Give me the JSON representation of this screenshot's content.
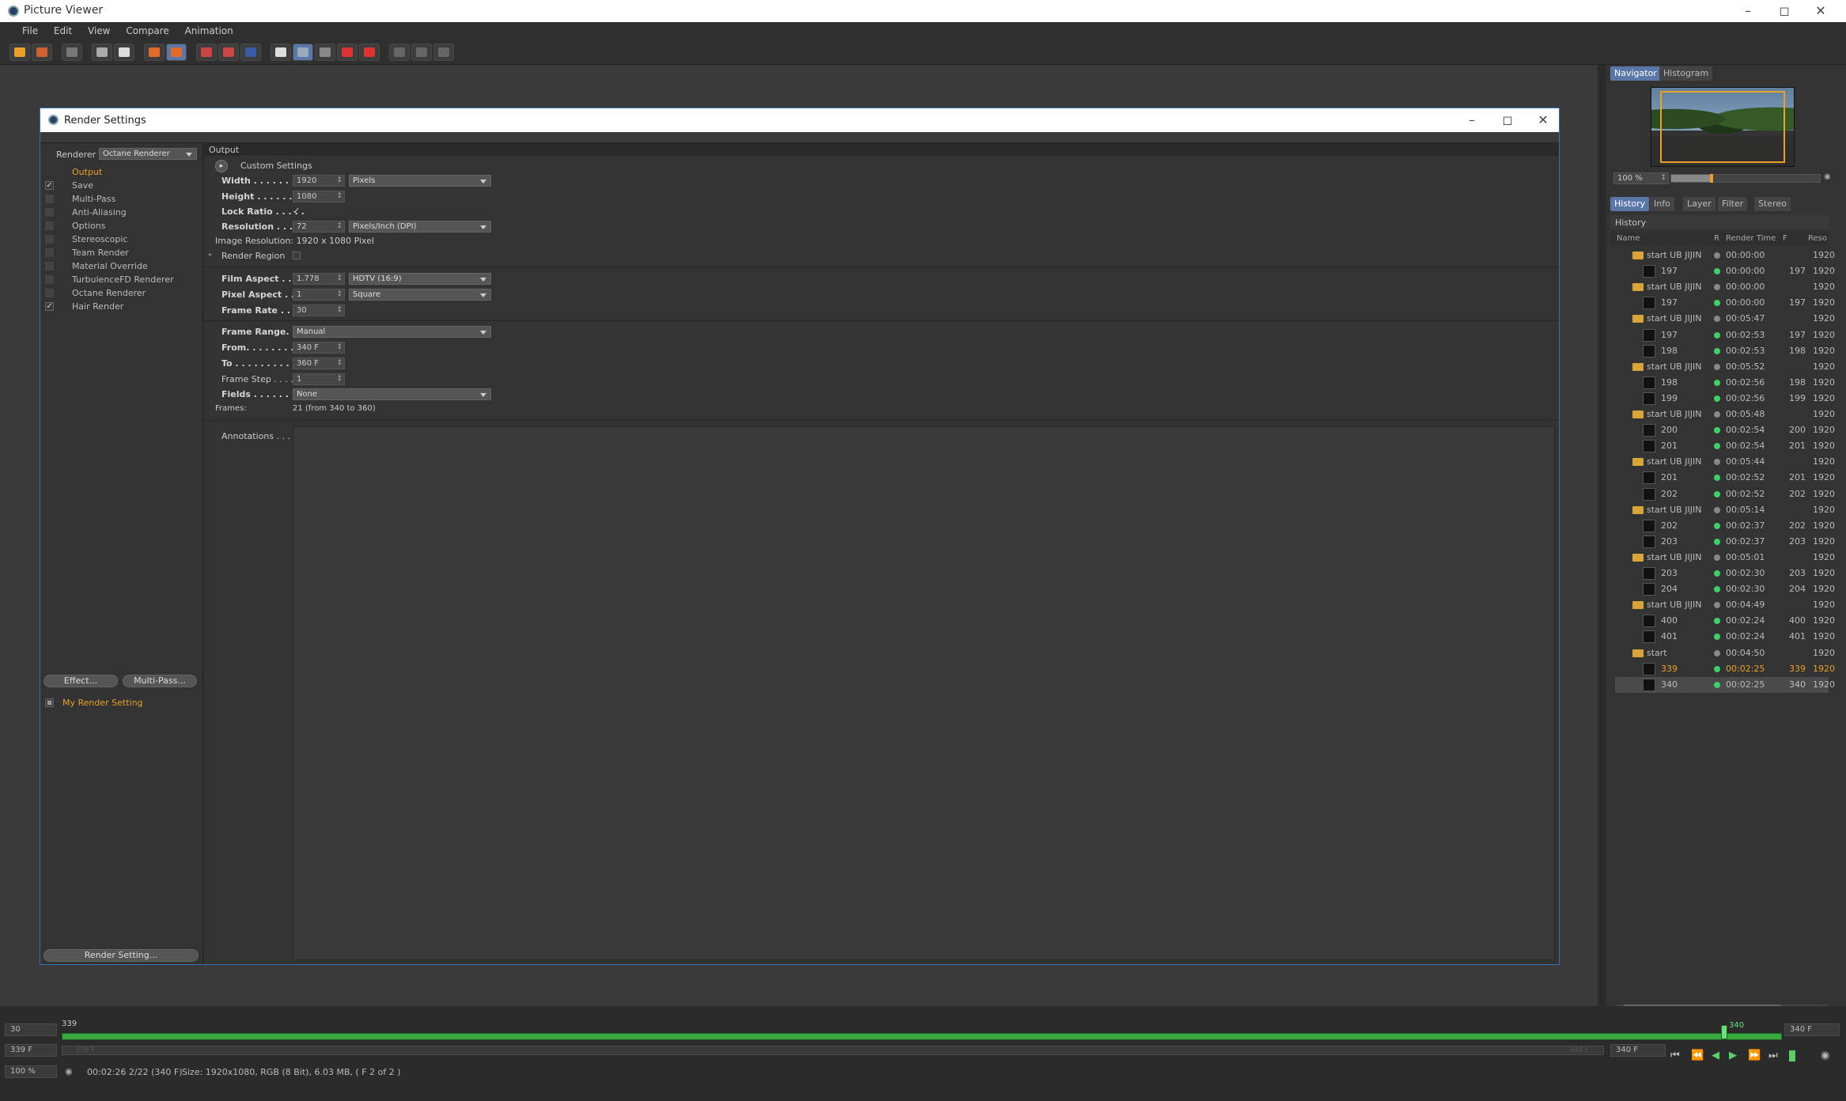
{
  "app": {
    "title": "Picture Viewer"
  },
  "menu": [
    "File",
    "Edit",
    "View",
    "Compare",
    "Animation"
  ],
  "window_controls": {
    "minimize": "–",
    "maximize": "◻",
    "close": "✕"
  },
  "dialog": {
    "title": "Render Settings",
    "renderer_label": "Renderer",
    "renderer_value": "Octane Renderer",
    "section_title": "Output",
    "settings_tree": [
      {
        "label": "Output",
        "checked": "",
        "active": true
      },
      {
        "label": "Save",
        "checked": "✓"
      },
      {
        "label": "Multi-Pass",
        "checked": ""
      },
      {
        "label": "Anti-Aliasing",
        "checked": ""
      },
      {
        "label": "Options",
        "checked": ""
      },
      {
        "label": "Stereoscopic",
        "checked": ""
      },
      {
        "label": "Team Render",
        "checked": ""
      },
      {
        "label": "Material Override",
        "checked": ""
      },
      {
        "label": "TurbulenceFD Renderer",
        "checked": ""
      },
      {
        "label": "Octane Renderer",
        "checked": ""
      },
      {
        "label": "Hair Render",
        "checked": "✓"
      }
    ],
    "effect_button": "Effect...",
    "multipass_button": "Multi-Pass...",
    "render_setting_name": "My Render Setting",
    "render_setting_button": "Render Setting...",
    "output": {
      "preset_label": "Custom Settings",
      "width_label": "Width . . . . . . . . .",
      "width_value": "1920",
      "width_unit": "Pixels",
      "height_label": "Height . . . . . . . .",
      "height_value": "1080",
      "lock_ratio_label": "Lock Ratio . . . . .",
      "lock_ratio_check": "✓",
      "resolution_label": "Resolution . . . . .",
      "resolution_value": "72",
      "resolution_unit": "Pixels/Inch (DPI)",
      "image_resolution": "Image Resolution: 1920 x 1080 Pixel",
      "render_region_label": "Render Region",
      "film_aspect_label": "Film Aspect . . . .",
      "film_aspect_value": "1.778",
      "film_aspect_preset": "HDTV (16:9)",
      "pixel_aspect_label": "Pixel Aspect . . .",
      "pixel_aspect_value": "1",
      "pixel_aspect_preset": "Square",
      "frame_rate_label": "Frame Rate . . . .",
      "frame_rate_value": "30",
      "frame_range_label": "Frame Range. . .",
      "frame_range_value": "Manual",
      "from_label": "From. . . . . . . . . . .",
      "from_value": "340 F",
      "to_label": "To . . . . . . . . . . . .",
      "to_value": "360 F",
      "frame_step_label": "Frame Step . . . .",
      "frame_step_value": "1",
      "fields_label": "Fields . . . . . . . . .",
      "fields_value": "None",
      "frames_label": "Frames:",
      "frames_value": "21 (from 340 to 360)",
      "annotations_label": "Annotations . . . ."
    }
  },
  "right_panel": {
    "tabs_top": [
      "Navigator",
      "Histogram"
    ],
    "zoom": "100 %",
    "tabs_mid": [
      "History",
      "Info",
      "Layer",
      "Filter",
      "Stereo"
    ],
    "history_title": "History",
    "columns": [
      "Name",
      "R",
      "Render Time",
      "F",
      "Reso"
    ],
    "rows": [
      {
        "type": "group",
        "name": "start UB JIJIN",
        "time": "00:00:00",
        "frame": "",
        "res": "1920",
        "dot": "#888888"
      },
      {
        "type": "child",
        "name": "197",
        "time": "00:00:00",
        "frame": "197",
        "res": "1920",
        "dot": "#3fcf6a"
      },
      {
        "type": "group",
        "name": "start UB JIJIN",
        "time": "00:00:00",
        "frame": "",
        "res": "1920",
        "dot": "#888888"
      },
      {
        "type": "child",
        "name": "197",
        "time": "00:00:00",
        "frame": "197",
        "res": "1920",
        "dot": "#3fcf6a"
      },
      {
        "type": "group",
        "name": "start UB JIJIN",
        "time": "00:05:47",
        "frame": "",
        "res": "1920",
        "dot": "#888888"
      },
      {
        "type": "child",
        "name": "197",
        "time": "00:02:53",
        "frame": "197",
        "res": "1920",
        "dot": "#3fcf6a"
      },
      {
        "type": "child",
        "name": "198",
        "time": "00:02:53",
        "frame": "198",
        "res": "1920",
        "dot": "#3fcf6a"
      },
      {
        "type": "group",
        "name": "start UB JIJIN",
        "time": "00:05:52",
        "frame": "",
        "res": "1920",
        "dot": "#888888"
      },
      {
        "type": "child",
        "name": "198",
        "time": "00:02:56",
        "frame": "198",
        "res": "1920",
        "dot": "#3fcf6a"
      },
      {
        "type": "child",
        "name": "199",
        "time": "00:02:56",
        "frame": "199",
        "res": "1920",
        "dot": "#3fcf6a"
      },
      {
        "type": "group",
        "name": "start UB JIJIN",
        "time": "00:05:48",
        "frame": "",
        "res": "1920",
        "dot": "#888888"
      },
      {
        "type": "child",
        "name": "200",
        "time": "00:02:54",
        "frame": "200",
        "res": "1920",
        "dot": "#3fcf6a"
      },
      {
        "type": "child",
        "name": "201",
        "time": "00:02:54",
        "frame": "201",
        "res": "1920",
        "dot": "#3fcf6a"
      },
      {
        "type": "group",
        "name": "start UB JIJIN",
        "time": "00:05:44",
        "frame": "",
        "res": "1920",
        "dot": "#888888"
      },
      {
        "type": "child",
        "name": "201",
        "time": "00:02:52",
        "frame": "201",
        "res": "1920",
        "dot": "#3fcf6a"
      },
      {
        "type": "child",
        "name": "202",
        "time": "00:02:52",
        "frame": "202",
        "res": "1920",
        "dot": "#3fcf6a"
      },
      {
        "type": "group",
        "name": "start UB JIJIN",
        "time": "00:05:14",
        "frame": "",
        "res": "1920",
        "dot": "#888888"
      },
      {
        "type": "child",
        "name": "202",
        "time": "00:02:37",
        "frame": "202",
        "res": "1920",
        "dot": "#3fcf6a"
      },
      {
        "type": "child",
        "name": "203",
        "time": "00:02:37",
        "frame": "203",
        "res": "1920",
        "dot": "#3fcf6a"
      },
      {
        "type": "group",
        "name": "start UB JIJIN",
        "time": "00:05:01",
        "frame": "",
        "res": "1920",
        "dot": "#888888"
      },
      {
        "type": "child",
        "name": "203",
        "time": "00:02:30",
        "frame": "203",
        "res": "1920",
        "dot": "#3fcf6a"
      },
      {
        "type": "child",
        "name": "204",
        "time": "00:02:30",
        "frame": "204",
        "res": "1920",
        "dot": "#3fcf6a"
      },
      {
        "type": "group",
        "name": "start UB JIJIN",
        "time": "00:04:49",
        "frame": "",
        "res": "1920",
        "dot": "#888888"
      },
      {
        "type": "child",
        "name": "400",
        "time": "00:02:24",
        "frame": "400",
        "res": "1920",
        "dot": "#3fcf6a"
      },
      {
        "type": "child",
        "name": "401",
        "time": "00:02:24",
        "frame": "401",
        "res": "1920",
        "dot": "#3fcf6a"
      },
      {
        "type": "group",
        "name": "start",
        "time": "00:04:50",
        "frame": "",
        "res": "1920",
        "dot": "#888888"
      },
      {
        "type": "child",
        "name": "339",
        "time": "00:02:25",
        "frame": "339",
        "res": "1920",
        "dot": "#3fcf6a",
        "highlight": true
      },
      {
        "type": "child",
        "name": "340",
        "time": "00:02:25",
        "frame": "340",
        "res": "1920",
        "dot": "#3fcf6a",
        "selected": true
      }
    ]
  },
  "timeline": {
    "start_field": "30",
    "start_marker": "339",
    "current_marker": "340",
    "end_field": "340 F",
    "frame_field": "339 F",
    "scrub_left": "339 F",
    "scrub_right": "340 F",
    "frame_field_right": "340 F",
    "zoom": "100 %",
    "status": "00:02:26 2/22 (340 F)",
    "info": "Size: 1920x1080, RGB (8 Bit), 6.03 MB,  ( F 2 of 2 )"
  },
  "colors": {
    "accent": "#e9a12a",
    "selection": "#5b77a8",
    "timeline_green": "#37a83c",
    "dot_green": "#3fcf6a"
  }
}
